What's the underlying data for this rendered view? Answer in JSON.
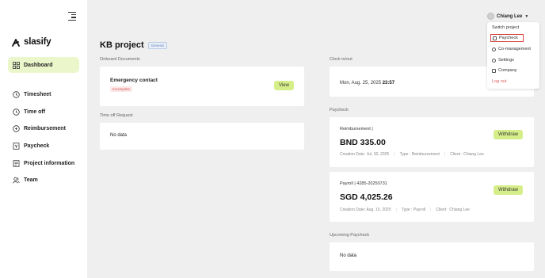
{
  "sidebar": {
    "logo_text": "slasify",
    "items": [
      {
        "label": "Dashboard",
        "icon": "dashboard-icon"
      },
      {
        "label": "Timesheet",
        "icon": "clock-icon"
      },
      {
        "label": "Time off",
        "icon": "clock-icon"
      },
      {
        "label": "Reimbursement",
        "icon": "reimbursement-icon"
      },
      {
        "label": "Paycheck",
        "icon": "paycheck-icon"
      },
      {
        "label": "Project information",
        "icon": "document-icon"
      },
      {
        "label": "Team",
        "icon": "team-icon"
      }
    ]
  },
  "header": {
    "title": "KB project",
    "tag": "General",
    "user_name": "Chiang Lee"
  },
  "user_menu": {
    "items": [
      "Switch project",
      "Paycheck",
      "Co-management",
      "Settings",
      "Company",
      "Log out"
    ]
  },
  "onboard": {
    "section_label": "Onboard Documents",
    "title": "Emergency contact",
    "status": "Incomplete",
    "button": "View"
  },
  "time_off": {
    "section_label": "Time off Request",
    "empty": "No data"
  },
  "clock": {
    "section_label": "Clock in/out",
    "date": "Mon, Aug. 25, 2025",
    "time": "23:57"
  },
  "paycheck": {
    "section_label": "Paycheck",
    "items": [
      {
        "type": "Reimbursement |",
        "amount": "BND 335.00",
        "creation_date": "Creation Date:  Jul. 30, 2025",
        "type_meta": "Type :  Reimbursement",
        "client": "Client :  Chiang Lee",
        "button": "Withdraw"
      },
      {
        "type": "Payroll | 4285-20250731",
        "amount": "SGD 4,025.26",
        "creation_date": "Creation Date:  Aug. 10, 2025",
        "type_meta": "Type :  Payroll",
        "client": "Client :  Chiang Lee",
        "button": "Withdraw"
      }
    ]
  },
  "upcoming": {
    "section_label": "Upcoming Paycheck",
    "empty": "No data"
  },
  "colors": {
    "accent": "#d6ee8a",
    "active_nav": "#ecf6cb",
    "danger": "#d9453f"
  }
}
